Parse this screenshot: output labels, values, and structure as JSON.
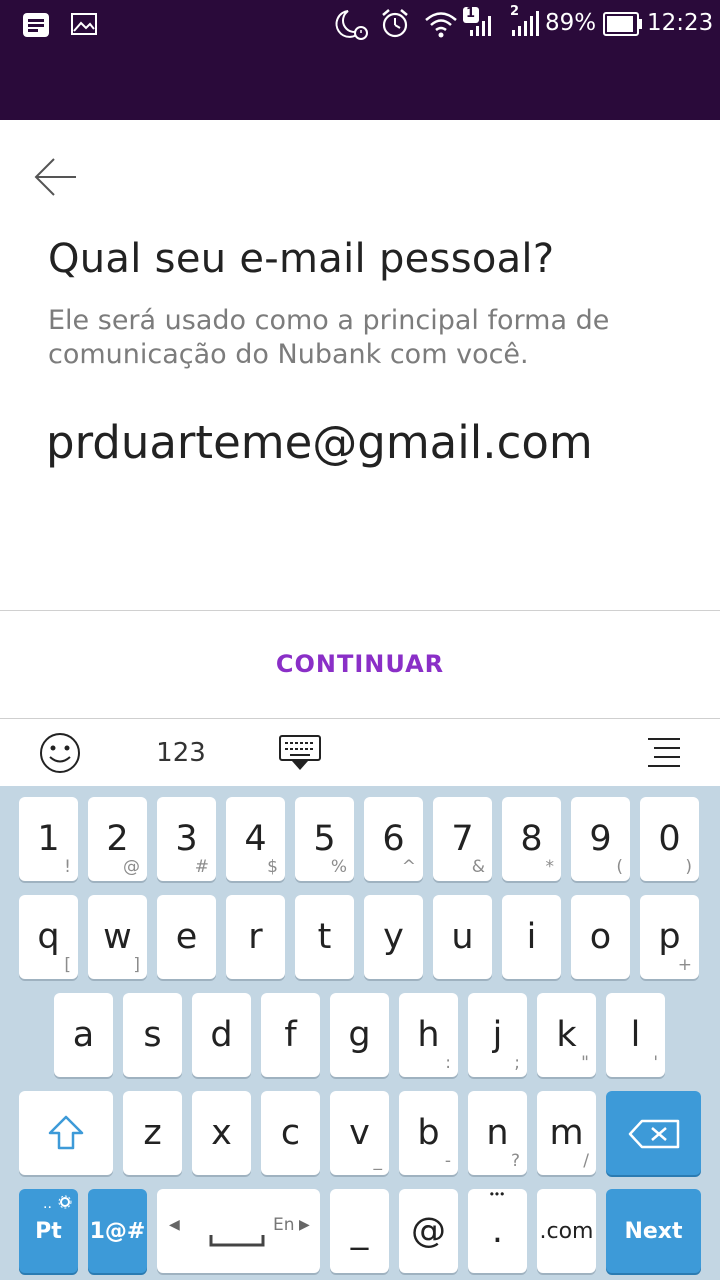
{
  "status_bar": {
    "battery": "89%",
    "time": "12:23",
    "sim1_badge": "1",
    "sim2_badge": "2",
    "icons": [
      "notes-icon",
      "image-icon",
      "moon-alarm-icon",
      "alarm-clock-icon",
      "wifi-icon",
      "signal-sim1-icon",
      "signal-sim2-icon",
      "battery-icon"
    ]
  },
  "header": {
    "title": "Qual seu e-mail pessoal?",
    "subtitle": "Ele será usado como a principal forma de comunicação do Nubank com você."
  },
  "email": {
    "value": "prduarteme@gmail.com",
    "placeholder": ""
  },
  "actions": {
    "continue_label": "CONTINUAR"
  },
  "keyboard_toolbar": {
    "numbers_label": "123",
    "icons": [
      "emoji-icon",
      "keyboard-hide-icon",
      "menu-icon"
    ]
  },
  "keyboard": {
    "row1": [
      {
        "main": "1",
        "sub": "!"
      },
      {
        "main": "2",
        "sub": "@"
      },
      {
        "main": "3",
        "sub": "#"
      },
      {
        "main": "4",
        "sub": "$"
      },
      {
        "main": "5",
        "sub": "%"
      },
      {
        "main": "6",
        "sub": "^"
      },
      {
        "main": "7",
        "sub": "&"
      },
      {
        "main": "8",
        "sub": "*"
      },
      {
        "main": "9",
        "sub": "("
      },
      {
        "main": "0",
        "sub": ")"
      }
    ],
    "row2": [
      {
        "main": "q",
        "sub": "["
      },
      {
        "main": "w",
        "sub": "]"
      },
      {
        "main": "e",
        "sub": ""
      },
      {
        "main": "r",
        "sub": ""
      },
      {
        "main": "t",
        "sub": ""
      },
      {
        "main": "y",
        "sub": ""
      },
      {
        "main": "u",
        "sub": ""
      },
      {
        "main": "i",
        "sub": ""
      },
      {
        "main": "o",
        "sub": ""
      },
      {
        "main": "p",
        "sub": "+"
      }
    ],
    "row3": [
      {
        "main": "a",
        "sub": ""
      },
      {
        "main": "s",
        "sub": ""
      },
      {
        "main": "d",
        "sub": ""
      },
      {
        "main": "f",
        "sub": ""
      },
      {
        "main": "g",
        "sub": ""
      },
      {
        "main": "h",
        "sub": ":"
      },
      {
        "main": "j",
        "sub": ";"
      },
      {
        "main": "k",
        "sub": "\""
      },
      {
        "main": "l",
        "sub": "'"
      }
    ],
    "row4": [
      {
        "main": "z",
        "sub": ""
      },
      {
        "main": "x",
        "sub": ""
      },
      {
        "main": "c",
        "sub": ""
      },
      {
        "main": "v",
        "sub": "_"
      },
      {
        "main": "b",
        "sub": "-"
      },
      {
        "main": "n",
        "sub": "?"
      },
      {
        "main": "m",
        "sub": "/"
      }
    ],
    "lang_label": "Pt",
    "symbols_label": "1@#",
    "space_lang_label": "En",
    "underscore_label": "_",
    "at_label": "@",
    "period_label": ".",
    "period_extra": "•••",
    "dotcom_label": ".com",
    "next_label": "Next"
  },
  "colors": {
    "status_bar_bg": "#2a0a3a",
    "accent": "#8a2fc7",
    "keyboard_bg": "#c3d6e3",
    "key_blue": "#3d9ad8"
  }
}
